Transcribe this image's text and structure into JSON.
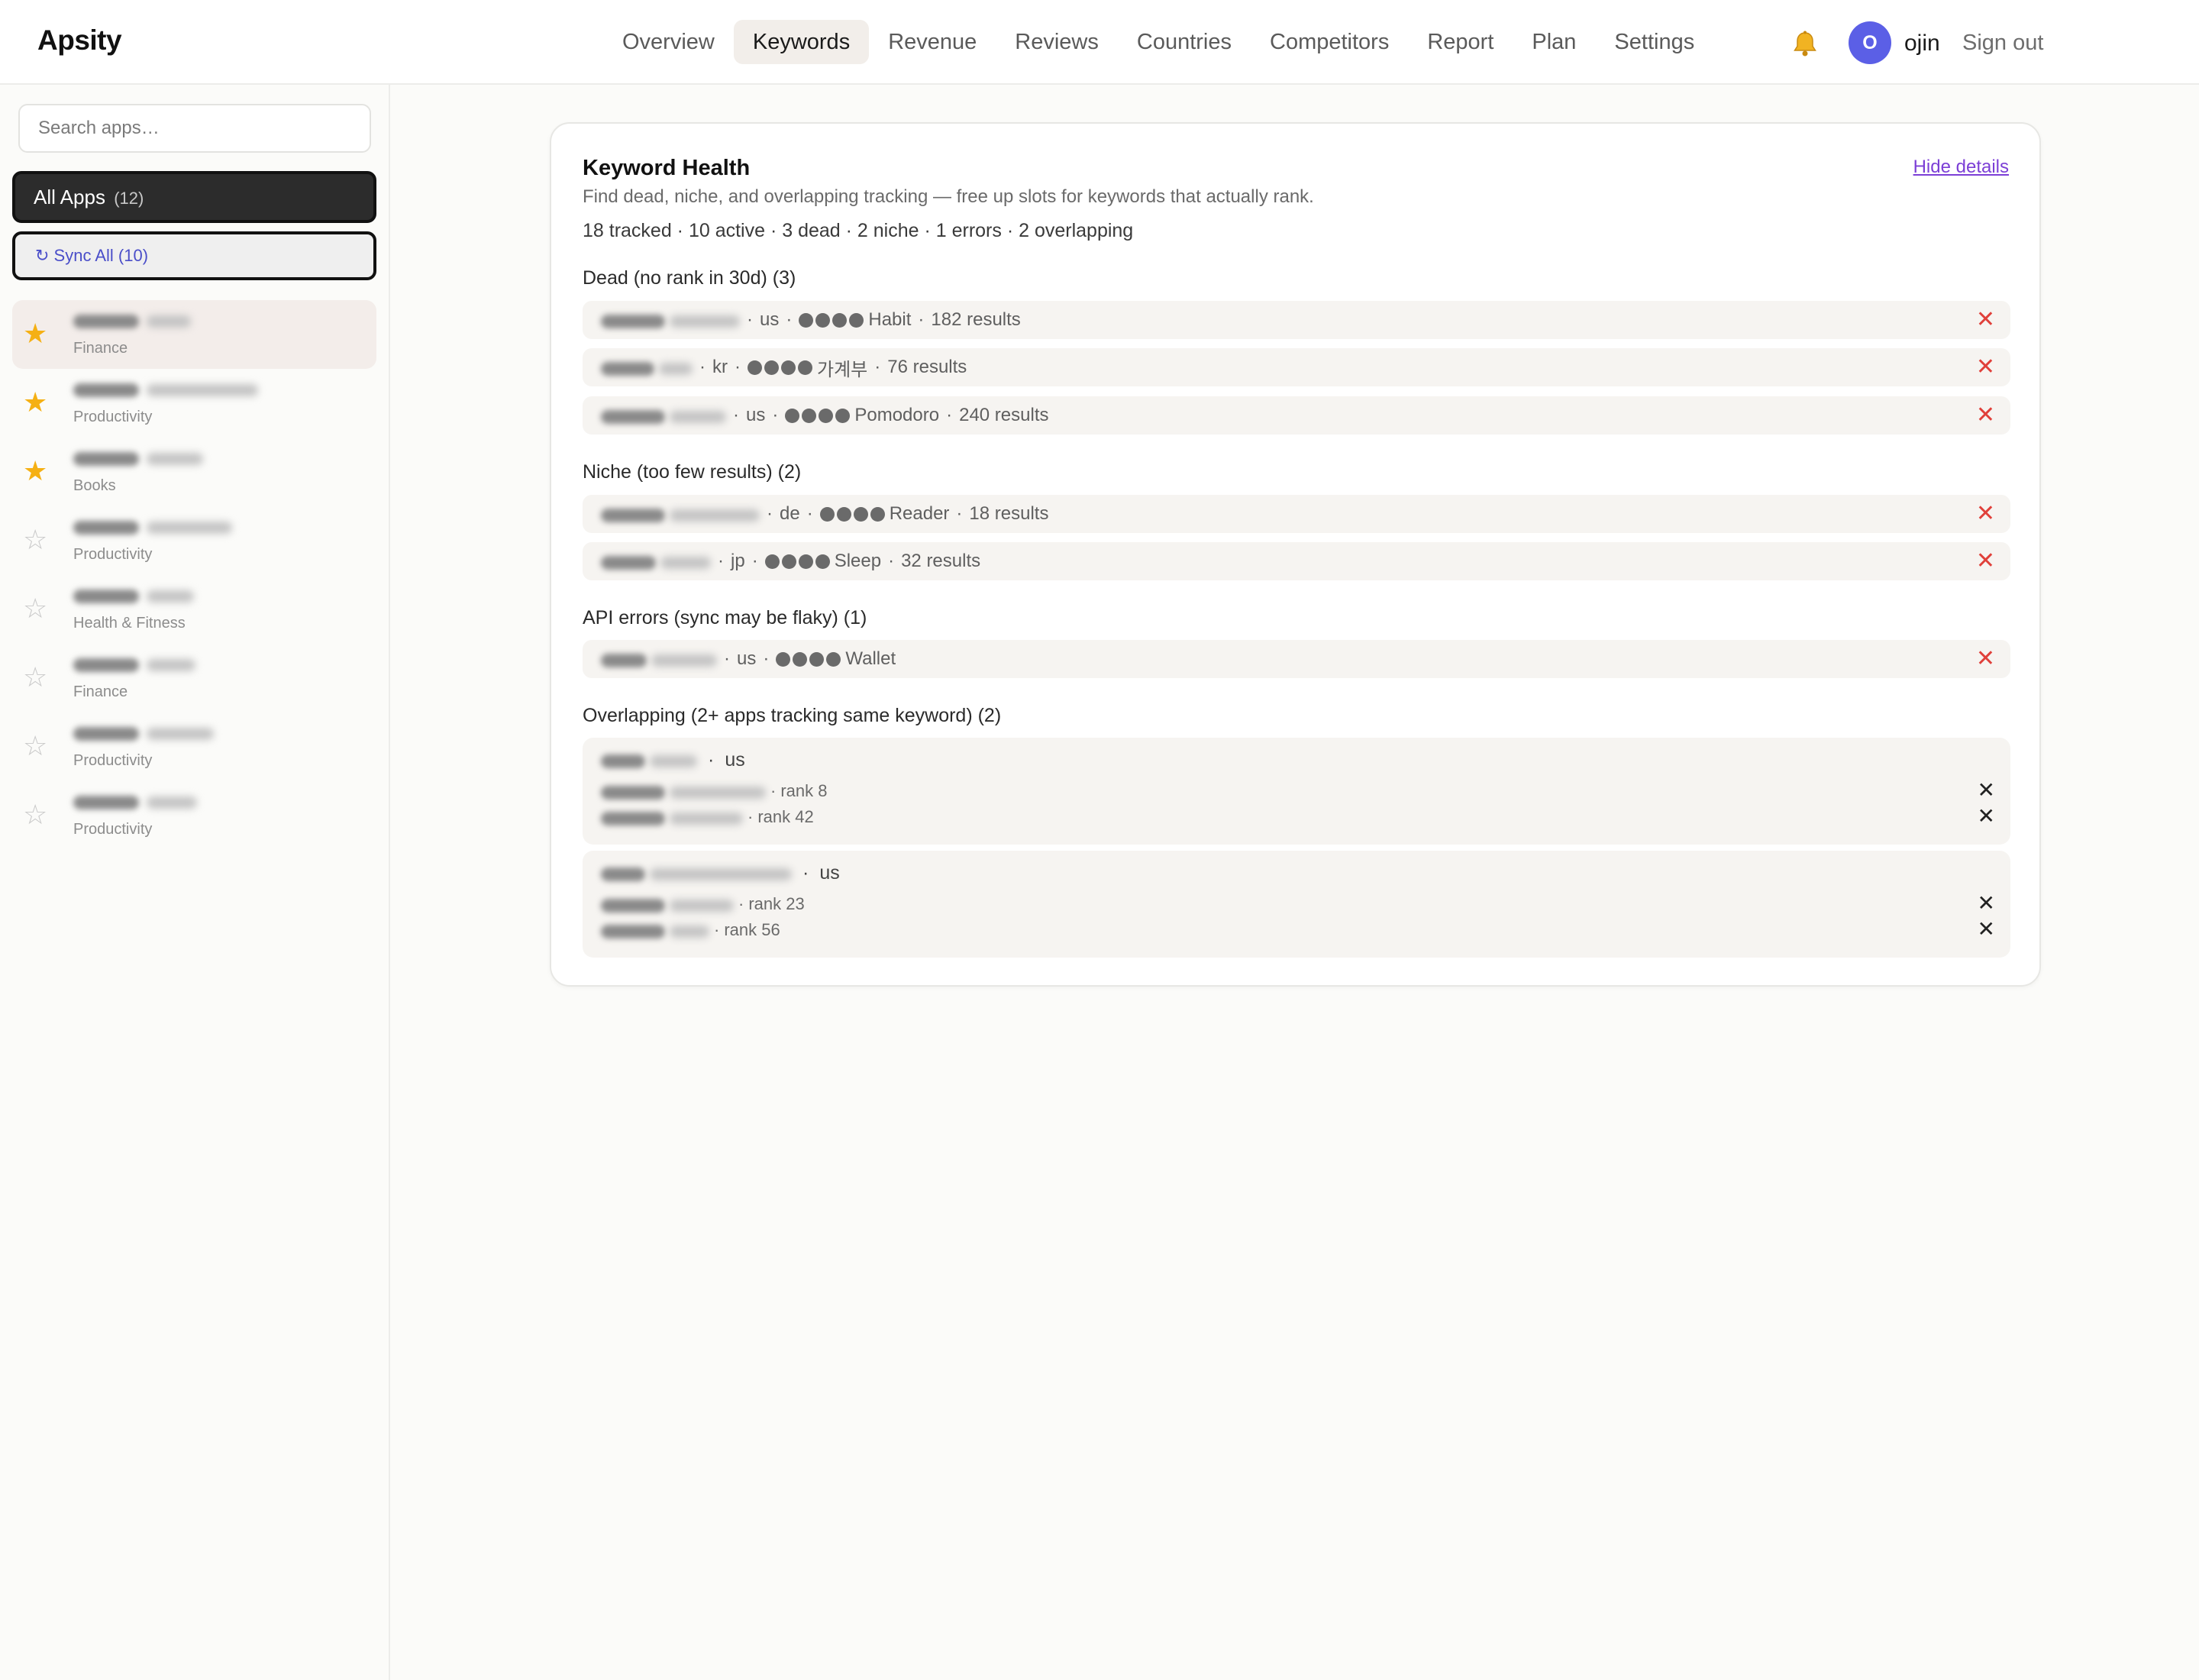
{
  "app": {
    "title": "Apsity"
  },
  "nav": {
    "tabs": [
      {
        "label": "Overview",
        "active": false
      },
      {
        "label": "Keywords",
        "active": true
      },
      {
        "label": "Revenue",
        "active": false
      },
      {
        "label": "Reviews",
        "active": false
      },
      {
        "label": "Countries",
        "active": false
      },
      {
        "label": "Competitors",
        "active": false
      },
      {
        "label": "Report",
        "active": false
      },
      {
        "label": "Plan",
        "active": false
      },
      {
        "label": "Settings",
        "active": false
      }
    ],
    "bell_icon": "bell-icon",
    "avatar_initial": "O",
    "username": "ojin",
    "signout": "Sign out"
  },
  "sidebar": {
    "search_placeholder": "Search apps…",
    "all_apps_label": "All Apps",
    "all_apps_count": "(12)",
    "sync_label": "↻ Sync All (10)",
    "apps": [
      {
        "category": "Finance",
        "favorite": true,
        "selected": true
      },
      {
        "category": "Productivity",
        "favorite": true,
        "selected": false
      },
      {
        "category": "Books",
        "favorite": true,
        "selected": false
      },
      {
        "category": "Productivity",
        "favorite": false,
        "selected": false
      },
      {
        "category": "Health & Fitness",
        "favorite": false,
        "selected": false
      },
      {
        "category": "Finance",
        "favorite": false,
        "selected": false
      },
      {
        "category": "Productivity",
        "favorite": false,
        "selected": false
      },
      {
        "category": "Productivity",
        "favorite": false,
        "selected": false
      }
    ]
  },
  "health": {
    "title": "Keyword Health",
    "hide_details": "Hide details",
    "subtitle": "Find dead, niche, and overlapping tracking — free up slots for keywords that actually rank.",
    "stats": "18 tracked · 10 active · 3 dead · 2 niche · 1 errors · 2 overlapping",
    "dead": {
      "heading": "Dead (no rank in 30d) (3)",
      "rows": [
        {
          "country": "us",
          "app": "Habit",
          "results": "182 results"
        },
        {
          "country": "kr",
          "app": "가계부",
          "results": "76 results"
        },
        {
          "country": "us",
          "app": "Pomodoro",
          "results": "240 results"
        }
      ]
    },
    "niche": {
      "heading": "Niche (too few results) (2)",
      "rows": [
        {
          "country": "de",
          "app": "Reader",
          "results": "18 results"
        },
        {
          "country": "jp",
          "app": "Sleep",
          "results": "32 results"
        }
      ]
    },
    "errors": {
      "heading": "API errors (sync may be flaky) (1)",
      "rows": [
        {
          "country": "us",
          "app": "Wallet"
        }
      ]
    },
    "overlapping": {
      "heading": "Overlapping (2+ apps tracking same keyword) (2)",
      "groups": [
        {
          "country": "us",
          "apps": [
            {
              "rank": "rank 8"
            },
            {
              "rank": "rank 42"
            }
          ]
        },
        {
          "country": "us",
          "apps": [
            {
              "rank": "rank 23"
            },
            {
              "rank": "rank 56"
            }
          ]
        }
      ]
    }
  },
  "colors": {
    "accent": "#5b5fe6",
    "link": "#7c3fd6",
    "star": "#f5b014",
    "remove": "#e0403a"
  }
}
